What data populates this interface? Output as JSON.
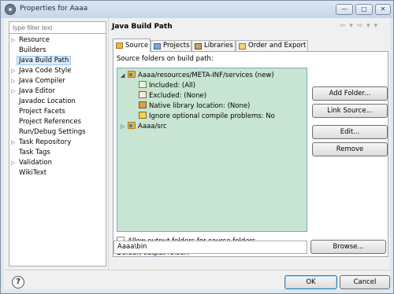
{
  "window": {
    "title": "Properties for Aaaa",
    "minimize": "—",
    "maximize": "□",
    "close": "✕"
  },
  "nav": {
    "filter_placeholder": "type filter text",
    "items": [
      {
        "label": "Resource",
        "expander": "▷"
      },
      {
        "label": "Builders",
        "expander": ""
      },
      {
        "label": "Java Build Path",
        "expander": "",
        "selected": true
      },
      {
        "label": "Java Code Style",
        "expander": "▷"
      },
      {
        "label": "Java Compiler",
        "expander": "▷"
      },
      {
        "label": "Java Editor",
        "expander": "▷"
      },
      {
        "label": "Javadoc Location",
        "expander": ""
      },
      {
        "label": "Project Facets",
        "expander": ""
      },
      {
        "label": "Project References",
        "expander": ""
      },
      {
        "label": "Run/Debug Settings",
        "expander": ""
      },
      {
        "label": "Task Repository",
        "expander": "▷"
      },
      {
        "label": "Task Tags",
        "expander": ""
      },
      {
        "label": "Validation",
        "expander": "▷"
      },
      {
        "label": "WikiText",
        "expander": ""
      }
    ]
  },
  "page": {
    "title": "Java Build Path",
    "nav_arrows": "⇦ ▾ ⇨ ▾ ▾"
  },
  "tabs": [
    {
      "label": "Source",
      "active": true
    },
    {
      "label": "Projects",
      "active": false
    },
    {
      "label": "Libraries",
      "active": false
    },
    {
      "label": "Order and Export",
      "active": false
    }
  ],
  "source": {
    "section_label": "Source folders on build path:",
    "tree": [
      {
        "label": "Aaaa/resources/META-INF/services (new)",
        "expander": "◢",
        "icon": "folder-icon"
      },
      {
        "label": "Included: (All)",
        "icon": "included-icon"
      },
      {
        "label": "Excluded: (None)",
        "icon": "excluded-icon"
      },
      {
        "label": "Native library location: (None)",
        "icon": "native-library-icon"
      },
      {
        "label": "Ignore optional compile problems: No",
        "icon": "warning-icon"
      },
      {
        "label": "Aaaa/src",
        "expander": "▷",
        "icon": "folder-icon"
      }
    ],
    "buttons": {
      "add_folder": "Add Folder...",
      "link_source": "Link Source...",
      "edit": "Edit...",
      "remove": "Remove"
    },
    "allow_output_label": "Allow output folders for source folders",
    "default_output_label": "Default output folder:",
    "default_output_value": "Aaaa\\bin",
    "browse": "Browse..."
  },
  "footer": {
    "help": "?",
    "ok": "OK",
    "cancel": "Cancel"
  }
}
